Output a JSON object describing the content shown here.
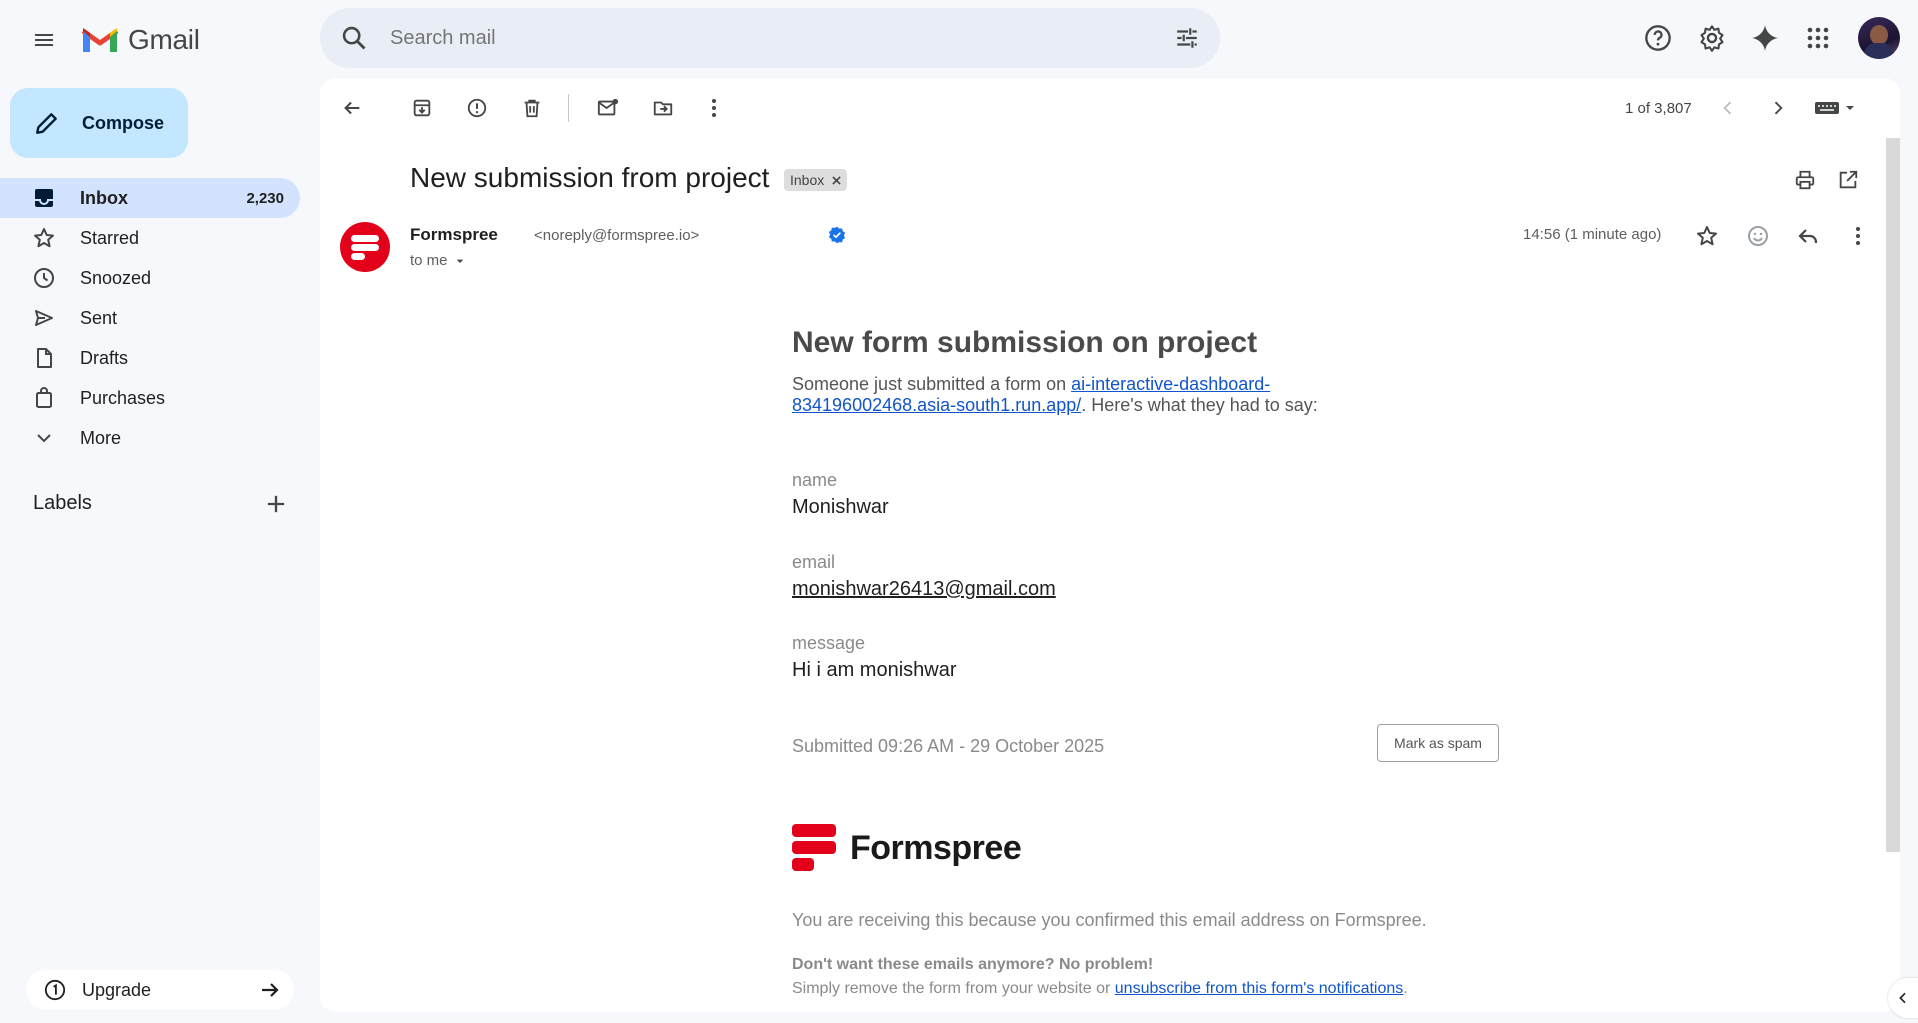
{
  "app": {
    "name": "Gmail"
  },
  "search": {
    "placeholder": "Search mail"
  },
  "compose": {
    "label": "Compose"
  },
  "nav": [
    {
      "label": "Inbox",
      "count": "2,230",
      "icon": "inbox-icon"
    },
    {
      "label": "Starred",
      "icon": "star-icon"
    },
    {
      "label": "Snoozed",
      "icon": "clock-icon"
    },
    {
      "label": "Sent",
      "icon": "send-icon"
    },
    {
      "label": "Drafts",
      "icon": "draft-icon"
    },
    {
      "label": "Purchases",
      "icon": "shopping-bag-icon"
    },
    {
      "label": "More",
      "icon": "chevron-down-icon"
    }
  ],
  "labels": {
    "title": "Labels"
  },
  "upgrade": {
    "label": "Upgrade"
  },
  "pager": {
    "text": "1 of 3,807"
  },
  "message": {
    "subject": "New submission from project",
    "label_chip": "Inbox",
    "sender_name": "Formspree",
    "sender_email": "<noreply@formspree.io>",
    "recipient": "to me",
    "time": "14:56 (1 minute ago)"
  },
  "email_body": {
    "heading": "New form submission on project",
    "intro_prefix": "Someone just submitted a form on ",
    "intro_link": "ai-interactive-dashboard-834196002468.asia-south1.run.app/",
    "intro_suffix": ". Here's what they had to say:",
    "fields": [
      {
        "label": "name",
        "value": "Monishwar"
      },
      {
        "label": "email",
        "value": "monishwar26413@gmail.com"
      },
      {
        "label": "message",
        "value": "Hi i am monishwar"
      }
    ],
    "submitted": "Submitted 09:26 AM - 29 October 2025",
    "spam_button": "Mark as spam",
    "brand": "Formspree",
    "footer_line1": "You are receiving this because you confirmed this email address on Formspree.",
    "footer_line2": "Don't want these emails anymore? No problem!",
    "footer_line3_prefix": "Simply remove the form from your website or ",
    "footer_line3_link": "unsubscribe from this form's notifications",
    "footer_line3_suffix": "."
  },
  "colors": {
    "accent": "#0b57d0",
    "compose_bg": "#c2e7ff",
    "active_nav": "#d3e3fd",
    "brand_red": "#e3001b"
  }
}
